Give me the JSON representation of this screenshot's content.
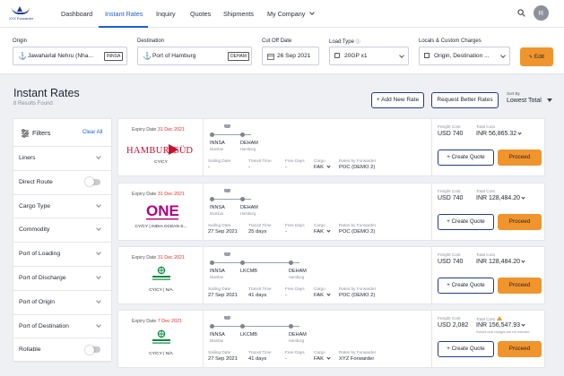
{
  "app": {
    "logo_text": "XYZ Forwarder",
    "avatar_initial": "R"
  },
  "nav": {
    "items": [
      "Dashboard",
      "Instant Rates",
      "Inquiry",
      "Quotes",
      "Shipments",
      "My Company"
    ],
    "active": "Instant Rates"
  },
  "search_bar": {
    "origin_label": "Origin",
    "origin_value": "Jawaharlal Nehru (Nha...",
    "origin_code": "INNSA",
    "destination_label": "Destination",
    "destination_value": "Port of Hamburg",
    "destination_code": "DEHAM",
    "cutoff_label": "Cut Off Date",
    "cutoff_value": "26 Sep 2021",
    "load_label": "Load Type",
    "load_value": "20GP x1",
    "charges_label": "Locals & Custom Charges",
    "charges_value": "Origin, Destination ...",
    "edit_label": "Edit"
  },
  "page": {
    "title": "Instant Rates",
    "subtitle": "8 Results Found",
    "add_rate": "+ Add New Rate",
    "request_rates": "Request Better Rates",
    "sort_label": "Sort By",
    "sort_value": "Lowest Total"
  },
  "filters": {
    "title": "Filters",
    "clear_all": "Clear All",
    "items": [
      {
        "label": "Liners",
        "kind": "dropdown"
      },
      {
        "label": "Direct Route",
        "kind": "toggle"
      },
      {
        "label": "Cargo Type",
        "kind": "dropdown"
      },
      {
        "label": "Commodity",
        "kind": "dropdown"
      },
      {
        "label": "Port of Loading",
        "kind": "dropdown"
      },
      {
        "label": "Port of Discharge",
        "kind": "dropdown"
      },
      {
        "label": "Port of Origin",
        "kind": "dropdown"
      },
      {
        "label": "Port of Destination",
        "kind": "dropdown"
      },
      {
        "label": "Rollable",
        "kind": "toggle"
      }
    ]
  },
  "labels": {
    "expiry": "Expiry Date",
    "sailing": "Sailing Date",
    "transit": "Transit Time",
    "free_days": "Free Days",
    "cargo": "Cargo",
    "rates_by": "Rates by Forwarder",
    "freight_cost": "Freight Cost",
    "total_cost": "Total Cost",
    "create_quote": "+ Create Quote",
    "proceed": "Proceed"
  },
  "colors": {
    "accent": "#1d5fd1",
    "orange": "#f0952e",
    "navy": "#1f3c88",
    "danger": "#d9302c"
  },
  "rates": [
    {
      "expiry_date": "31 Dec 2021",
      "carrier_text": "CY/CY",
      "carrier_logo": "hamburg-sud-logo",
      "ports": [
        {
          "code": "INNSA",
          "name": "Mumbai"
        },
        {
          "code": "DEHAM",
          "name": "Hamburg"
        }
      ],
      "sailing_date": "-",
      "transit_time": "-",
      "free_days": "-",
      "cargo": "FAK",
      "rates_by": "POC (DEMO 2)",
      "freight_cost": "USD 740",
      "total_cost": "INR 56,865.32",
      "total_note": ""
    },
    {
      "expiry_date": "31 Dec 2021",
      "carrier_text": "CY/CY | INDIA OCEAN S...",
      "carrier_logo": "one-logo",
      "ports": [
        {
          "code": "INNSA",
          "name": "Mumbai"
        },
        {
          "code": "DEHAM",
          "name": "Hamburg"
        }
      ],
      "sailing_date": "27 Sep 2021",
      "transit_time": "25 days",
      "free_days": "-",
      "cargo": "FAK",
      "rates_by": "POC (DEMO 2)",
      "freight_cost": "USD 740",
      "total_cost": "INR 128,484.20",
      "total_note": ""
    },
    {
      "expiry_date": "31 Dec 2021",
      "carrier_text": "CY/CY | N/A",
      "carrier_logo": "cosco-logo",
      "ports": [
        {
          "code": "INNSA",
          "name": "Mumbai"
        },
        {
          "code": "LKCMB",
          "name": ""
        },
        {
          "code": "DEHAM",
          "name": "Hamburg"
        }
      ],
      "sailing_date": "27 Sep 2021",
      "transit_time": "41 days",
      "free_days": "-",
      "cargo": "FAK",
      "rates_by": "POC (DEMO 2)",
      "freight_cost": "USD 740",
      "total_cost": "INR 128,484.20",
      "total_note": ""
    },
    {
      "expiry_date": "7 Dec 2021",
      "carrier_text": "CY/CY | N/A",
      "carrier_logo": "cosco-logo",
      "ports": [
        {
          "code": "INNSA",
          "name": "Mumbai"
        },
        {
          "code": "LKCMB",
          "name": ""
        },
        {
          "code": "DEHAM",
          "name": "Hamburg"
        }
      ],
      "sailing_date": "27 Sep 2021",
      "transit_time": "41 days",
      "free_days": "-",
      "cargo": "FAK",
      "rates_by": "XYZ Forwarder",
      "freight_cost": "USD 2,082",
      "total_cost": "INR 156,547.93",
      "total_note": "Some/Local charges are not included"
    }
  ]
}
